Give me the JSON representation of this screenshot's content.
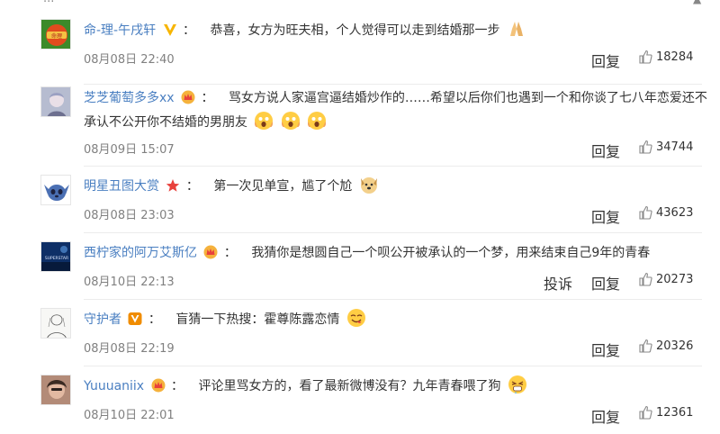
{
  "top_fragment": {
    "text": "...",
    "icon": "thumb-icon"
  },
  "reply_label": "回复",
  "report_label": "投诉",
  "comments": [
    {
      "username": "命-理-午戌轩",
      "badge": "v-orange-icon",
      "text": "恭喜，女方为旺夫相，个人觉得可以走到结婚那一步",
      "emojis": [
        "pray-icon"
      ],
      "date": "08月08日 22:40",
      "likes": "18284",
      "avatar": "avatar-orange-logo"
    },
    {
      "username": "芝芝葡萄多多xx",
      "badge": "crown-icon",
      "text": "骂女方说人家逼宫逼结婚炒作的……希望以后你们也遇到一个和你谈了七八年恋爱还不",
      "text2": "承认不公开你不结婚的男朋友",
      "emojis": [
        "shocked-face-icon",
        "shocked-face-icon",
        "shocked-face-icon"
      ],
      "date": "08月09日 15:07",
      "likes": "34744",
      "avatar": "avatar-anime"
    },
    {
      "username": "明星丑图大赏",
      "badge": "star-icon",
      "text": "第一次见单宣，尴了个尬",
      "emojis": [
        "dog-face-icon"
      ],
      "date": "08月08日 23:03",
      "likes": "43623",
      "avatar": "avatar-stitch"
    },
    {
      "username": "西柠家的阿万艾斯亿",
      "badge": "crown-icon",
      "text": "我猜你是想圆自己一个呗公开被承认的一个梦，用来结束自己9年的青春",
      "emojis": [],
      "date": "08月10日 22:13",
      "likes": "20273",
      "report": true,
      "avatar": "avatar-superstar"
    },
    {
      "username": "守护者",
      "badge": "v-box-icon",
      "text": "盲猜一下热搜：霍尊陈露恋情",
      "emojis": [
        "yummy-face-icon"
      ],
      "date": "08月08日 22:19",
      "likes": "20326",
      "avatar": "avatar-sketch"
    },
    {
      "username": "Yuuuaniix",
      "badge": "crown-icon",
      "text": "评论里骂女方的，看了最新微博没有？九年青春喂了狗",
      "emojis": [
        "drool-face-icon"
      ],
      "date": "08月10日 22:01",
      "likes": "12361",
      "avatar": "avatar-photo"
    }
  ],
  "colors": {
    "username": "#4a7fc1",
    "date": "#808080",
    "divider": "#ececec",
    "badge_orange": "#f7b500",
    "crown_red": "#e8413c"
  }
}
